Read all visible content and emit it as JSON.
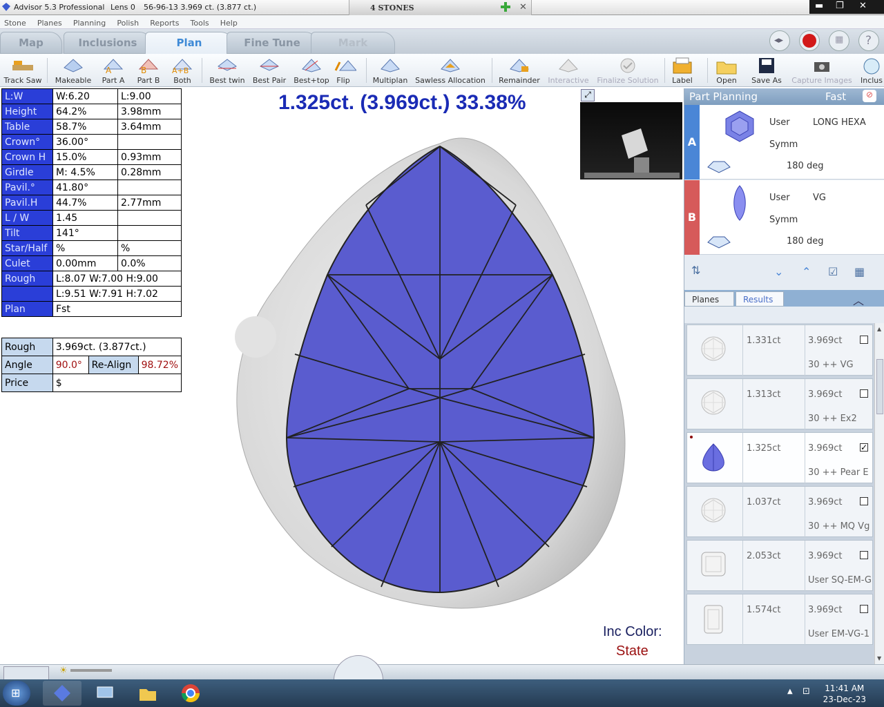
{
  "titlebar": {
    "app": "Advisor 5.3 Professional",
    "lens": "Lens 0",
    "info": "56-96-13   3.969 ct. (3.877 ct.)",
    "stones": "4 STONES",
    "add_icon": "plus-icon",
    "close_doc_icon": "x-icon"
  },
  "menu": [
    "Stone",
    "Planes",
    "Planning",
    "Polish",
    "Reports",
    "Tools",
    "Help"
  ],
  "tabs": [
    "Map",
    "Inclusions",
    "Plan",
    "Fine Tune",
    "Mark"
  ],
  "toolbar": {
    "track_saw": "Track Saw",
    "makeable": "Makeable",
    "part_a": "Part A",
    "part_b": "Part B",
    "both": "Both",
    "best_twin": "Best twin",
    "best_pair": "Best Pair",
    "best_top": "Best+top",
    "flip": "Flip",
    "multiplan": "Multiplan",
    "sawless": "Sawless Allocation",
    "remainder": "Remainder",
    "interactive": "Interactive",
    "finalize": "Finalize Solution",
    "label": "Label",
    "open": "Open",
    "save_as": "Save As",
    "capture": "Capture Images",
    "inclus": "Inclus"
  },
  "metrics": [
    {
      "k": "L:W",
      "v1": "W:6.20",
      "v2": "L:9.00"
    },
    {
      "k": "Height",
      "v1": "64.2%",
      "v2": "3.98mm"
    },
    {
      "k": "Table",
      "v1": "58.7%",
      "v2": "3.64mm"
    },
    {
      "k": "Crown°",
      "v1": "36.00°",
      "v2": ""
    },
    {
      "k": "Crown H",
      "v1": "15.0%",
      "v2": "0.93mm"
    },
    {
      "k": "Girdle",
      "v1": "M: 4.5%",
      "v2": "0.28mm"
    },
    {
      "k": "Pavil.°",
      "v1": "41.80°",
      "v2": ""
    },
    {
      "k": "Pavil.H",
      "v1": "44.7%",
      "v2": "2.77mm"
    },
    {
      "k": "L / W",
      "v1": "1.45",
      "v2": ""
    },
    {
      "k": "Tilt",
      "v1": "141°",
      "v2": ""
    },
    {
      "k": "Star/Half",
      "v1": "%",
      "v2": "%"
    },
    {
      "k": "Culet",
      "v1": "0.00mm",
      "v2": "0.0%"
    },
    {
      "k": "Rough",
      "v1": "L:8.07 W:7.00 H:9.00",
      "v2": ""
    },
    {
      "k": "",
      "v1": "L:9.51 W:7.91 H:7.02",
      "v2": ""
    },
    {
      "k": "Plan",
      "v1": "Fst",
      "v2": ""
    }
  ],
  "rough_box": {
    "rough_label": "Rough",
    "rough_value": "3.969ct. (3.877ct.)",
    "angle_label": "Angle",
    "angle_value": "90.0°",
    "realign_label": "Re-Align",
    "realign_value": "98.72%",
    "price_label": "Price",
    "price_value": "$"
  },
  "main": {
    "result_title": "1.325ct. (3.969ct.) 33.38%",
    "inc_color_label": "Inc Color:",
    "inc_color_value": "State"
  },
  "part_planning": {
    "title": "Part Planning",
    "mode": "Fast",
    "parts": [
      {
        "id": "A",
        "user": "User",
        "shape": "LONG HEXA",
        "symm": "Symm",
        "deg": "180 deg",
        "color": "#4a86d6"
      },
      {
        "id": "B",
        "user": "User",
        "shape": "VG",
        "symm": "Symm",
        "deg": "180 deg",
        "color": "#d65a5a"
      }
    ],
    "tabs": [
      "Planes",
      "Results"
    ]
  },
  "results": [
    {
      "ct": "1.331ct",
      "rough": "3.969ct",
      "desc": "30 ++  VG",
      "checked": false,
      "shape": "round"
    },
    {
      "ct": "1.313ct",
      "rough": "3.969ct",
      "desc": "30 ++  Ex2",
      "checked": false,
      "shape": "round"
    },
    {
      "ct": "1.325ct",
      "rough": "3.969ct",
      "desc": "30 ++  Pear E",
      "checked": true,
      "shape": "pear"
    },
    {
      "ct": "1.037ct",
      "rough": "3.969ct",
      "desc": "30 ++  MQ Vg",
      "checked": false,
      "shape": "round"
    },
    {
      "ct": "2.053ct",
      "rough": "3.969ct",
      "desc": "User SQ-EM-G",
      "checked": false,
      "shape": "square"
    },
    {
      "ct": "1.574ct",
      "rough": "3.969ct",
      "desc": "User EM-VG-1",
      "checked": false,
      "shape": "emerald"
    }
  ],
  "clock": {
    "time": "11:41 AM",
    "date": "23-Dec-23"
  }
}
